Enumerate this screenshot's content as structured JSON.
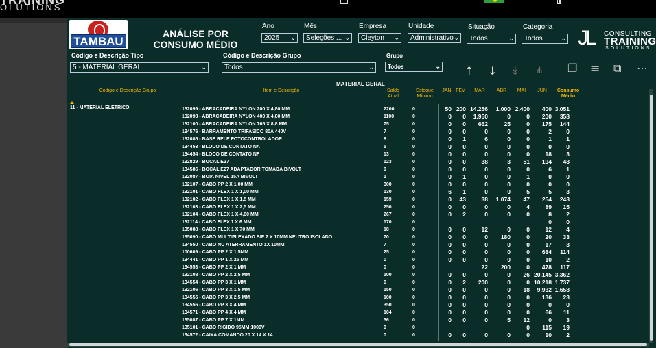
{
  "app": {
    "brand_top": "TRAINING",
    "brand_bottom": "OLUTIONS"
  },
  "header": {
    "logo_text": "TAMBAU",
    "title_line1": "ANÁLISE POR",
    "title_line2": "CONSUMO MÉDIO",
    "consulting": {
      "line1": "CONSULTING",
      "line2": "TRAINING",
      "line3": "SOLUTIONS"
    }
  },
  "filters": {
    "ano": {
      "label": "Ano",
      "value": "2025"
    },
    "mes": {
      "label": "Mês",
      "value": "Seleções ..."
    },
    "empresa": {
      "label": "Empresa",
      "value": "Cleyton"
    },
    "unidade": {
      "label": "Unidade",
      "value": "Administrativo"
    },
    "situacao": {
      "label": "Situação",
      "value": "Todos"
    },
    "categoria": {
      "label": "Categoria",
      "value": "Todos"
    },
    "tipo": {
      "label": "Código e Descrição Tipo",
      "value": "5 - MATERIAL GERAL"
    },
    "grupo_desc": {
      "label": "Código e Descrição Grupo",
      "value": "Todos"
    },
    "grupo": {
      "label": "Grupo",
      "value": "Todos"
    }
  },
  "table": {
    "title": "MATERIAL GERAL",
    "headers": {
      "grupo": "Código e Descrição Grupo",
      "item": "Item e Descrição",
      "saldo_l1": "Saldo",
      "saldo_l2": "Atual",
      "estoque_l1": "Estoque",
      "estoque_l2": "Mínimo",
      "jan": "JAN",
      "fev": "FEV",
      "mar": "MAR",
      "abr": "ABR",
      "mai": "MAI",
      "jun": "JUN",
      "consumo_l1": "Consumo",
      "consumo_l2": "Médio"
    },
    "group_label": "11 - MATERIAL ELETRICO",
    "rows": [
      {
        "desc": "132099 - ABRACADEIRA NYLON 200 X 4,80 MM",
        "saldo": "2200",
        "est": "0",
        "jan": "50",
        "fev": "200",
        "mar": "14.256",
        "abr": "1.000",
        "mai": "2.400",
        "jun": "400",
        "cm": "3.051"
      },
      {
        "desc": "132098 - ABRACADEIRA NYLON 400 X 4,80 MM",
        "saldo": "1100",
        "est": "0",
        "jan": "0",
        "fev": "0",
        "mar": "1.950",
        "abr": "0",
        "mai": "0",
        "jun": "200",
        "cm": "358"
      },
      {
        "desc": "132100 - ABRACADEIRA NYLON 765 X 8,8 MM",
        "saldo": "75",
        "est": "0",
        "jan": "0",
        "fev": "0",
        "mar": "662",
        "abr": "25",
        "mai": "0",
        "jun": "175",
        "cm": "144"
      },
      {
        "desc": "134576 - BARRAMENTO TRIFASICO 80A 440V",
        "saldo": "7",
        "est": "0",
        "jan": "0",
        "fev": "0",
        "mar": "0",
        "abr": "0",
        "mai": "0",
        "jun": "2",
        "cm": "0"
      },
      {
        "desc": "132086 - BASE RELE FOTOCONTROLADOR",
        "saldo": "8",
        "est": "0",
        "jan": "0",
        "fev": "1",
        "mar": "6",
        "abr": "0",
        "mai": "0",
        "jun": "1",
        "cm": "1"
      },
      {
        "desc": "134453 - BLOCO DE CONTATO NA",
        "saldo": "5",
        "est": "0",
        "jan": "0",
        "fev": "0",
        "mar": "0",
        "abr": "0",
        "mai": "0",
        "jun": "0",
        "cm": "0"
      },
      {
        "desc": "134454 - BLOCO DE CONTATO NF",
        "saldo": "13",
        "est": "0",
        "jan": "0",
        "fev": "0",
        "mar": "0",
        "abr": "0",
        "mai": "0",
        "jun": "18",
        "cm": "3"
      },
      {
        "desc": "132829 - BOCAL E27",
        "saldo": "123",
        "est": "0",
        "jan": "0",
        "fev": "0",
        "mar": "38",
        "abr": "3",
        "mai": "51",
        "jun": "194",
        "cm": "48"
      },
      {
        "desc": "134586 - BOCAL E27 ADAPTADOR TOMADA BIVOLT",
        "saldo": "0",
        "est": "0",
        "jan": "0",
        "fev": "0",
        "mar": "0",
        "abr": "0",
        "mai": "0",
        "jun": "6",
        "cm": "1"
      },
      {
        "desc": "132087 - BOIA NIVEL 15A BIVOLT",
        "saldo": "1",
        "est": "0",
        "jan": "0",
        "fev": "1",
        "mar": "0",
        "abr": "0",
        "mai": "1",
        "jun": "0",
        "cm": "0"
      },
      {
        "desc": "132107 - CABO PP 2 X 1,00 MM",
        "saldo": "300",
        "est": "0",
        "jan": "0",
        "fev": "0",
        "mar": "0",
        "abr": "0",
        "mai": "0",
        "jun": "0",
        "cm": "0"
      },
      {
        "desc": "132101 - CABO FLEX 1 X 1,00 MM",
        "saldo": "130",
        "est": "0",
        "jan": "6",
        "fev": "1",
        "mar": "0",
        "abr": "0",
        "mai": "5",
        "jun": "5",
        "cm": "3"
      },
      {
        "desc": "132102 - CABO FLEX 1 X 1,5 MM",
        "saldo": "159",
        "est": "0",
        "jan": "0",
        "fev": "43",
        "mar": "38",
        "abr": "1.074",
        "mai": "47",
        "jun": "254",
        "cm": "243"
      },
      {
        "desc": "132103 - CABO FLEX 1 X 2,5 MM",
        "saldo": "250",
        "est": "0",
        "jan": "0",
        "fev": "0",
        "mar": "0",
        "abr": "0",
        "mai": "4",
        "jun": "89",
        "cm": "15"
      },
      {
        "desc": "132104 - CABO FLEX 1 X 4,00 MM",
        "saldo": "267",
        "est": "0",
        "jan": "0",
        "fev": "2",
        "mar": "0",
        "abr": "0",
        "mai": "0",
        "jun": "8",
        "cm": "2"
      },
      {
        "desc": "132114 - CABO FLEX 1 X 6 MM",
        "saldo": "170",
        "est": "0",
        "jan": "",
        "fev": "",
        "mar": "",
        "abr": "",
        "mai": "",
        "jun": "0",
        "cm": "0"
      },
      {
        "desc": "135088 - CABO FLEX 1 X 70 MM",
        "saldo": "18",
        "est": "0",
        "jan": "0",
        "fev": "0",
        "mar": "12",
        "abr": "0",
        "mai": "0",
        "jun": "12",
        "cm": "4"
      },
      {
        "desc": "135090 - CABO MULTIPLEXADO BIF 2 X 10MM NEUTRO ISOLADO",
        "saldo": "70",
        "est": "0",
        "jan": "0",
        "fev": "0",
        "mar": "0",
        "abr": "180",
        "mai": "0",
        "jun": "20",
        "cm": "33"
      },
      {
        "desc": "134550 - CABO NU ATERRAMENTO 1X 10MM",
        "saldo": "7",
        "est": "0",
        "jan": "0",
        "fev": "0",
        "mar": "0",
        "abr": "0",
        "mai": "0",
        "jun": "17",
        "cm": "3"
      },
      {
        "desc": "100609 - CABO PP 2 X 1,5MM",
        "saldo": "25",
        "est": "0",
        "jan": "0",
        "fev": "0",
        "mar": "0",
        "abr": "0",
        "mai": "0",
        "jun": "684",
        "cm": "114"
      },
      {
        "desc": "134441 - CABO PP 1 X 25 MM",
        "saldo": "0",
        "est": "0",
        "jan": "0",
        "fev": "0",
        "mar": "0",
        "abr": "0",
        "mai": "0",
        "jun": "10",
        "cm": "2"
      },
      {
        "desc": "134553 - CABO PP 2 X 1 MM",
        "saldo": "0",
        "est": "0",
        "jan": "",
        "fev": "",
        "mar": "22",
        "abr": "200",
        "mai": "0",
        "jun": "478",
        "cm": "117"
      },
      {
        "desc": "132108 - CABO PP 2 X 2,5 MM",
        "saldo": "100",
        "est": "0",
        "jan": "0",
        "fev": "0",
        "mar": "0",
        "abr": "0",
        "mai": "26",
        "jun": "20.145",
        "cm": "3.362"
      },
      {
        "desc": "134554 - CABO PP 3 X 1 MM",
        "saldo": "0",
        "est": "0",
        "jan": "0",
        "fev": "2",
        "mar": "200",
        "abr": "0",
        "mai": "0",
        "jun": "10.218",
        "cm": "1.737"
      },
      {
        "desc": "132106 - CABO PP 3 X 1,5 MM",
        "saldo": "150",
        "est": "0",
        "jan": "0",
        "fev": "0",
        "mar": "0",
        "abr": "0",
        "mai": "18",
        "jun": "9.932",
        "cm": "1.658"
      },
      {
        "desc": "134555 - CABO PP 3 X 2,5 MM",
        "saldo": "100",
        "est": "0",
        "jan": "0",
        "fev": "0",
        "mar": "0",
        "abr": "0",
        "mai": "0",
        "jun": "136",
        "cm": "23"
      },
      {
        "desc": "134556 - CABO PP 3 X 4 MM",
        "saldo": "350",
        "est": "0",
        "jan": "0",
        "fev": "0",
        "mar": "0",
        "abr": "0",
        "mai": "0",
        "jun": "0",
        "cm": "0"
      },
      {
        "desc": "134571 - CABO PP 4 X 4 MM",
        "saldo": "104",
        "est": "0",
        "jan": "0",
        "fev": "0",
        "mar": "0",
        "abr": "0",
        "mai": "0",
        "jun": "66",
        "cm": "11"
      },
      {
        "desc": "135087 - CABO PP 7 X 1MM",
        "saldo": "36",
        "est": "0",
        "jan": "0",
        "fev": "0",
        "mar": "0",
        "abr": "5",
        "mai": "12",
        "jun": "0",
        "cm": "3"
      },
      {
        "desc": "135101 - CABO RIGIDO 95MM 1000V",
        "saldo": "0",
        "est": "0",
        "jan": "",
        "fev": "",
        "mar": "",
        "abr": "",
        "mai": "0",
        "jun": "115",
        "cm": "19"
      },
      {
        "desc": "134572 - CAIXA COMANDO 20 X 14 X 14",
        "saldo": "0",
        "est": "0",
        "jan": "0",
        "fev": "0",
        "mar": "0",
        "abr": "0",
        "mai": "0",
        "jun": "10",
        "cm": "2"
      }
    ]
  },
  "icons": {
    "sort_up": "arrow-up-icon",
    "sort_down": "arrow-down-icon",
    "expand_all": "double-arrow-down-icon",
    "hierarchy": "hierarchy-icon",
    "copy": "copy-icon",
    "filter": "filter-icon",
    "focus": "focus-mode-icon",
    "more": "more-options-icon"
  },
  "colors": {
    "background": "#0b2d2a",
    "header_text": "#f2b500",
    "logo_red": "#c8221f",
    "logo_blue": "#1f4e9a"
  }
}
